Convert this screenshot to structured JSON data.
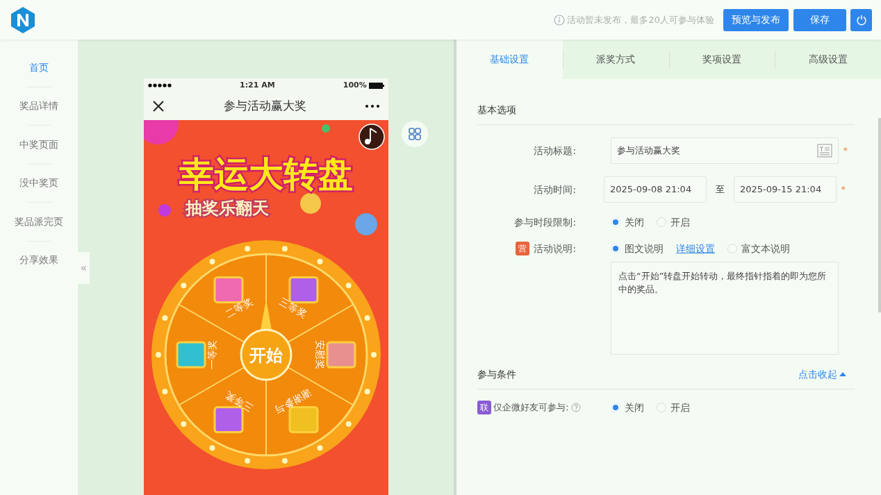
{
  "header": {
    "notice": "活动暂未发布，最多20人可参与体验",
    "buttons": [
      {
        "label": "预览与发布"
      },
      {
        "label": "保存"
      }
    ]
  },
  "sidebar": {
    "items": [
      {
        "label": "首页",
        "selected": true
      },
      {
        "label": "奖品详情",
        "selected": false
      },
      {
        "label": "中奖页面",
        "selected": false
      },
      {
        "label": "没中奖页",
        "selected": false
      },
      {
        "label": "奖品派完页",
        "selected": false
      },
      {
        "label": "分享效果",
        "selected": false
      }
    ],
    "collapse": "«"
  },
  "phone": {
    "time": "1:21 AM",
    "battery": "100%",
    "title": "参与活动赢大奖",
    "banner_title": "幸运大转盘",
    "banner_subtitle": "抽奖乐翻天",
    "start": "开始",
    "prizes": [
      {
        "label": "二等奖"
      },
      {
        "label": "三等奖"
      },
      {
        "label": "安慰奖"
      },
      {
        "label": "谢谢参与"
      },
      {
        "label": "三等奖"
      },
      {
        "label": "一等奖"
      }
    ]
  },
  "tabs": [
    {
      "label": "基础设置",
      "selected": true
    },
    {
      "label": "派奖方式",
      "selected": false
    },
    {
      "label": "奖项设置",
      "selected": false
    },
    {
      "label": "高级设置",
      "selected": false
    }
  ],
  "sections": [
    {
      "title": "基本选项",
      "fields": [
        {
          "kind": "text",
          "label": "活动标题:",
          "value": "参与活动赢大奖",
          "required": "*"
        },
        {
          "kind": "daterange",
          "label": "活动时间:",
          "start": "2025-09-08 21:04",
          "separator": "至",
          "end": "2025-09-15 21:04",
          "required": "*"
        },
        {
          "kind": "radio",
          "label": "参与时段限制:",
          "options": [
            {
              "label": "关闭",
              "selected": true
            },
            {
              "label": "开启",
              "selected": false
            }
          ]
        },
        {
          "kind": "radio",
          "label": "活动说明:",
          "badge": "营",
          "color": "#e8643c",
          "options": [
            {
              "label": "图文说明",
              "selected": true,
              "link": "详细设置"
            },
            {
              "label": "富文本说明",
              "selected": false
            }
          ],
          "textarea": "点击“开始”转盘开始转动，最终指针指着的即为您所中的奖品。"
        }
      ]
    },
    {
      "title": "参与条件",
      "toggle": "点击收起",
      "fields": [
        {
          "kind": "radio",
          "label": "仅企微好友可参与:",
          "badge": "联",
          "color": "#8a5cd6",
          "help": true,
          "options": [
            {
              "label": "关闭",
              "selected": true
            },
            {
              "label": "开启",
              "selected": false
            }
          ]
        }
      ]
    }
  ]
}
